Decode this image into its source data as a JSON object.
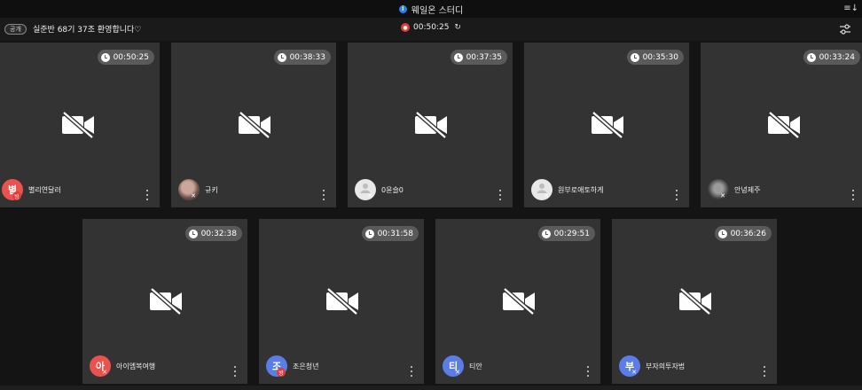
{
  "window": {
    "title": "웨일온 스터디",
    "info_glyph": "i",
    "sort_glyph": "≡↓"
  },
  "room": {
    "badge": "공개",
    "name": "실준반 68기 37조 환영합니다♡",
    "elapsed": "00:50:25",
    "rec_glyph": "●",
    "refresh_glyph": "↻"
  },
  "participants": [
    {
      "name": "별리연달러",
      "timer": "00:50:25",
      "initial": "별",
      "avatar": "red",
      "badge": "host"
    },
    {
      "name": "규키",
      "timer": "00:38:33",
      "initial": "",
      "avatar": "photo1",
      "badge": "muted"
    },
    {
      "name": "0윤슬0",
      "timer": "00:37:35",
      "initial": "",
      "avatar": "gray",
      "badge": "muted"
    },
    {
      "name": "원부로애토하게",
      "timer": "00:35:30",
      "initial": "",
      "avatar": "gray",
      "badge": "muted"
    },
    {
      "name": "안녕제주",
      "timer": "00:33:24",
      "initial": "",
      "avatar": "photo2",
      "badge": "muted"
    },
    {
      "name": "아이엠복여행",
      "timer": "00:32:38",
      "initial": "아",
      "avatar": "red",
      "badge": "muted"
    },
    {
      "name": "조은청년",
      "timer": "00:31:58",
      "initial": "조",
      "avatar": "blue",
      "badge": "host"
    },
    {
      "name": "티안",
      "timer": "00:29:51",
      "initial": "티",
      "avatar": "blue",
      "badge": "muted"
    },
    {
      "name": "부자의투자법",
      "timer": "00:36:26",
      "initial": "부",
      "avatar": "blue",
      "badge": "muted"
    }
  ],
  "badges": {
    "host": "방",
    "muted": "✕"
  },
  "colors": {
    "tile_bg": "#333333",
    "page_bg": "#141414",
    "red_avatar": "#e9524f",
    "blue_avatar": "#5b7de8",
    "rec": "#e53935",
    "info": "#2d7ff9"
  }
}
